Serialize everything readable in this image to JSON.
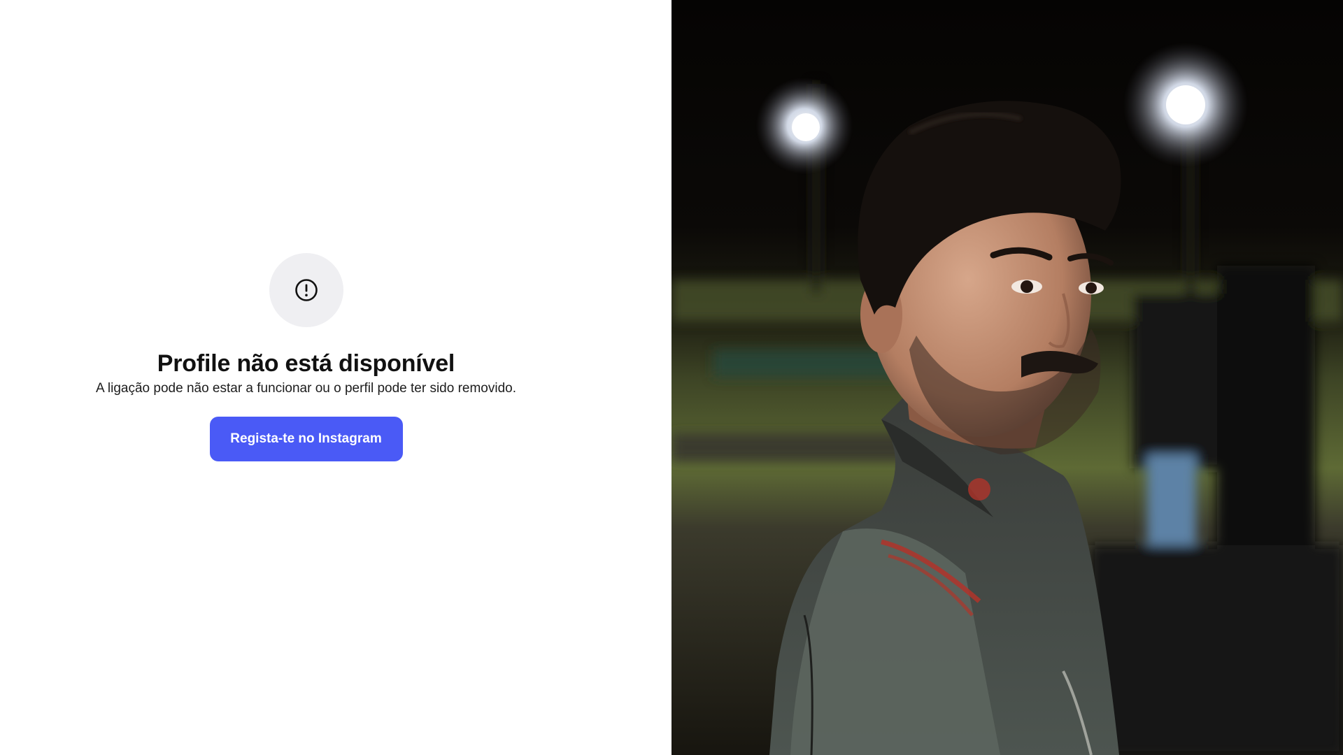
{
  "profile_unavailable": {
    "icon": "alert-circle-icon",
    "title": "Profile não está disponível",
    "message": "A ligação pode não estar a funcionar ou o perfil pode ter sido removido.",
    "signup_button_label": "Regista-te no Instagram",
    "accent_color": "#4a5af6",
    "icon_bg_color": "#efeff2"
  },
  "side_photo": {
    "subject": "man-in-racing-suit-at-night-track"
  }
}
